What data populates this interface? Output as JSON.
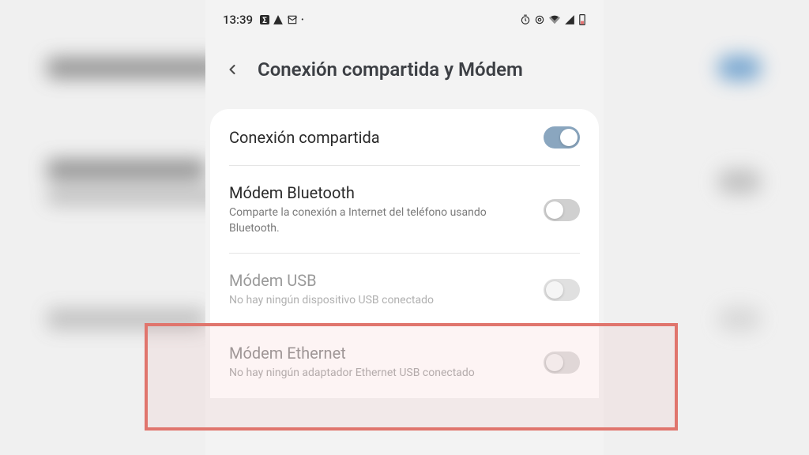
{
  "statusbar": {
    "time": "13:39"
  },
  "header": {
    "title": "Conexión compartida y Módem"
  },
  "settings": {
    "hotspot": {
      "title": "Conexión compartida",
      "state": "on"
    },
    "bluetooth": {
      "title": "Módem Bluetooth",
      "desc": "Comparte la conexión a Internet del teléfono usando Bluetooth.",
      "state": "off"
    },
    "usb": {
      "title": "Módem USB",
      "desc": "No hay ningún dispositivo USB conectado",
      "state": "disabled"
    },
    "ethernet": {
      "title": "Módem Ethernet",
      "desc": "No hay ningún adaptador Ethernet USB conectado",
      "state": "disabled"
    }
  }
}
